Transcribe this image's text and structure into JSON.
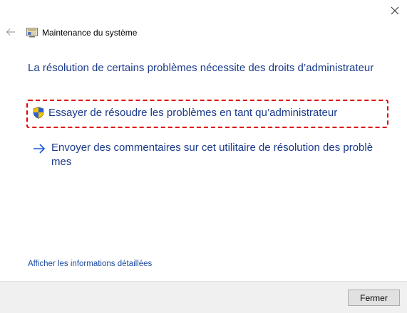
{
  "window": {
    "title": "Maintenance du système",
    "app_icon": "system-maintenance-icon",
    "back_icon": "back-arrow-icon",
    "close_icon": "close-icon"
  },
  "main": {
    "heading": "La résolution de certains problèmes nécessite des droits d’administrateur",
    "admin_option": {
      "icon": "uac-shield-icon",
      "label": "Essayer de résoudre les problèmes en tant qu’administrateur"
    },
    "feedback_option": {
      "icon": "arrow-right-icon",
      "label": "Envoyer des commentaires sur cet utilitaire de résolution des problè mes"
    },
    "details_link": "Afficher les informations détaillées"
  },
  "footer": {
    "close_label": "Fermer"
  },
  "colors": {
    "link": "#1a3a8a",
    "highlight": "#e00000",
    "footer_bg": "#f0f0f0"
  }
}
